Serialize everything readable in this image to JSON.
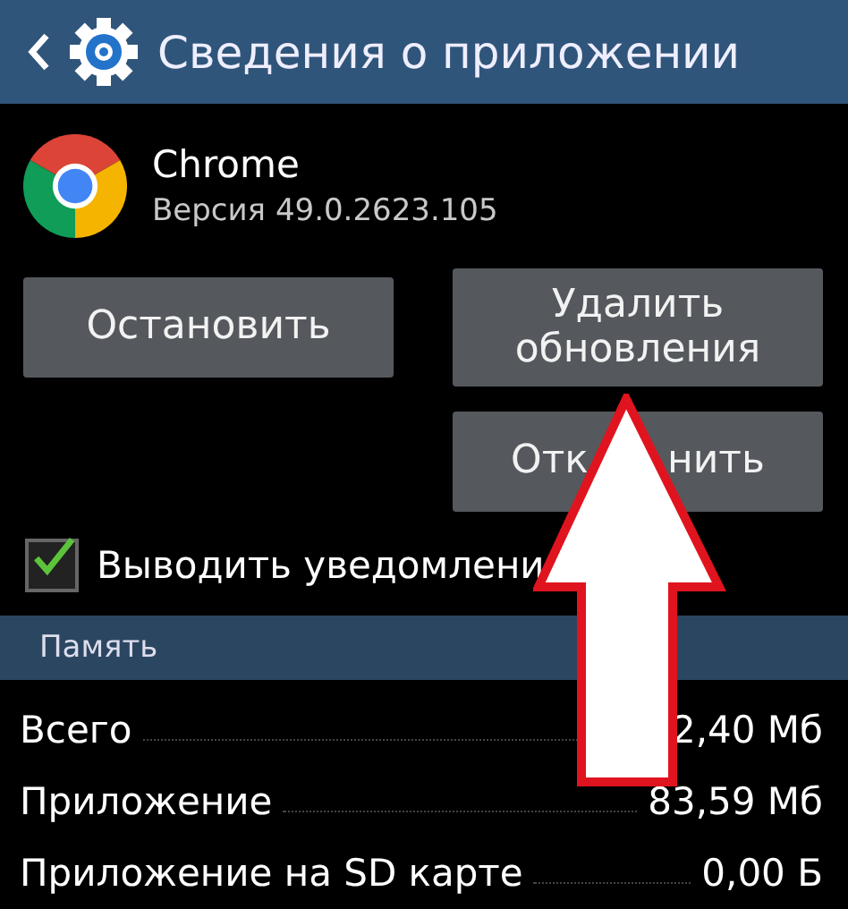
{
  "header": {
    "title": "Сведения о приложении"
  },
  "app": {
    "name": "Chrome",
    "version": "Версия 49.0.2623.105"
  },
  "buttons": {
    "stop": "Остановить",
    "uninstall_updates": [
      "Удалить",
      "обновления"
    ],
    "disable_parts": [
      "Отк",
      "нить"
    ]
  },
  "notifications": {
    "label": "Выводить уведомлени",
    "checked": true
  },
  "memory": {
    "title": "Память",
    "rows": [
      {
        "label": "Всего",
        "value": "2,40 Мб"
      },
      {
        "label": "Приложение",
        "value": "83,59 Мб"
      },
      {
        "label": "Приложение на SD карте",
        "value": "0,00 Б"
      }
    ]
  }
}
